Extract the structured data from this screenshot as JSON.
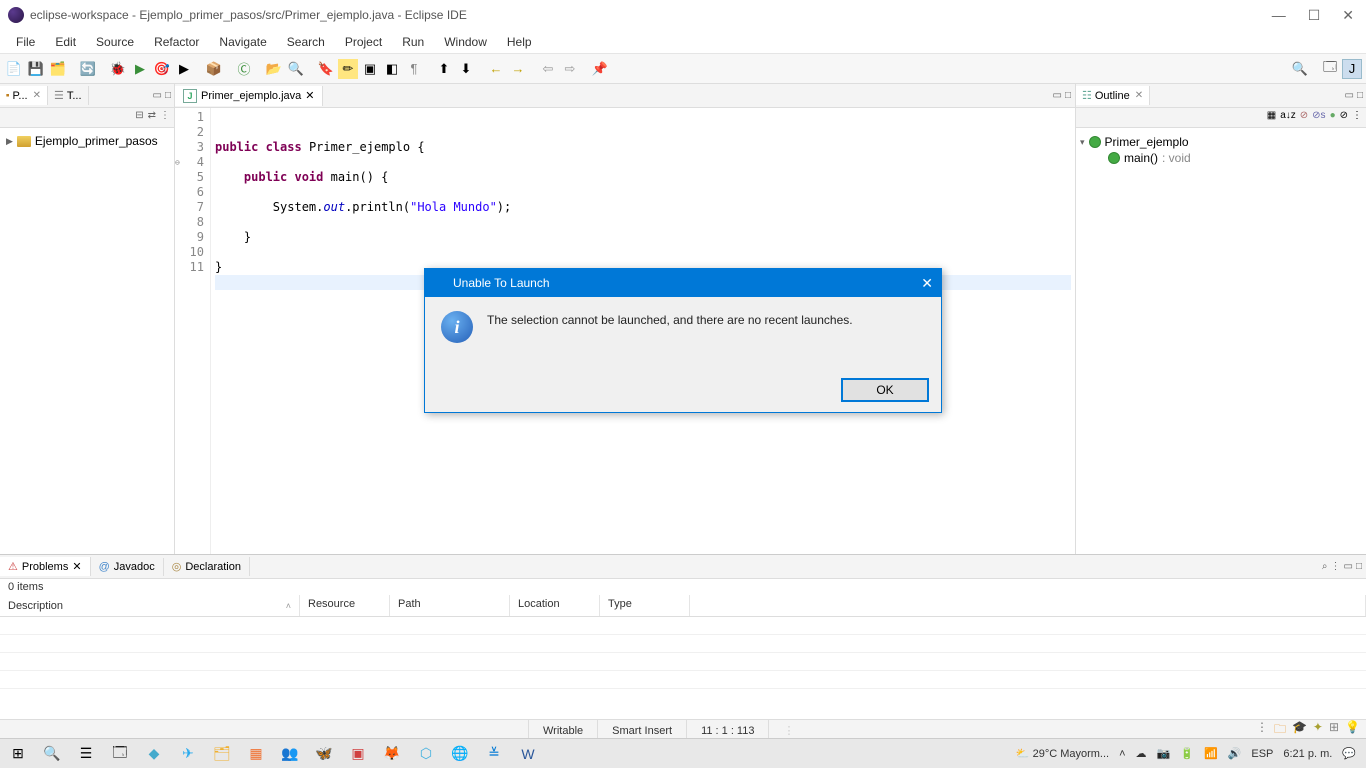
{
  "window": {
    "title": "eclipse-workspace - Ejemplo_primer_pasos/src/Primer_ejemplo.java - Eclipse IDE"
  },
  "menus": [
    "File",
    "Edit",
    "Source",
    "Refactor",
    "Navigate",
    "Search",
    "Project",
    "Run",
    "Window",
    "Help"
  ],
  "leftPanel": {
    "tab1": "P...",
    "tab2": "T...",
    "project": "Ejemplo_primer_pasos"
  },
  "editor": {
    "tab": "Primer_ejemplo.java",
    "lines": [
      "1",
      "2",
      "3",
      "4",
      "5",
      "6",
      "7",
      "8",
      "9",
      "10",
      "11"
    ],
    "code": {
      "l2a": "public",
      "l2b": " class",
      "l2c": " Primer_ejemplo {",
      "l4a": "    public",
      "l4b": " void",
      "l4c": " main() {",
      "l6a": "        System.",
      "l6b": "out",
      "l6c": ".println(",
      "l6d": "\"Hola Mundo\"",
      "l6e": ");",
      "l8": "    }",
      "l10": "}"
    }
  },
  "outline": {
    "title": "Outline",
    "class": "Primer_ejemplo",
    "method": "main()",
    "methodType": " : void"
  },
  "problems": {
    "tab1": "Problems",
    "tab2": "Javadoc",
    "tab3": "Declaration",
    "count": "0 items",
    "cols": [
      "Description",
      "Resource",
      "Path",
      "Location",
      "Type"
    ]
  },
  "status": {
    "writable": "Writable",
    "mode": "Smart Insert",
    "pos": "11 : 1 : 113"
  },
  "dialog": {
    "title": "Unable To Launch",
    "message": "The selection cannot be launched, and there are no recent launches.",
    "ok": "OK"
  },
  "taskbar": {
    "weather": "29°C  Mayorm...",
    "lang": "ESP",
    "time": "6:21 p. m."
  }
}
